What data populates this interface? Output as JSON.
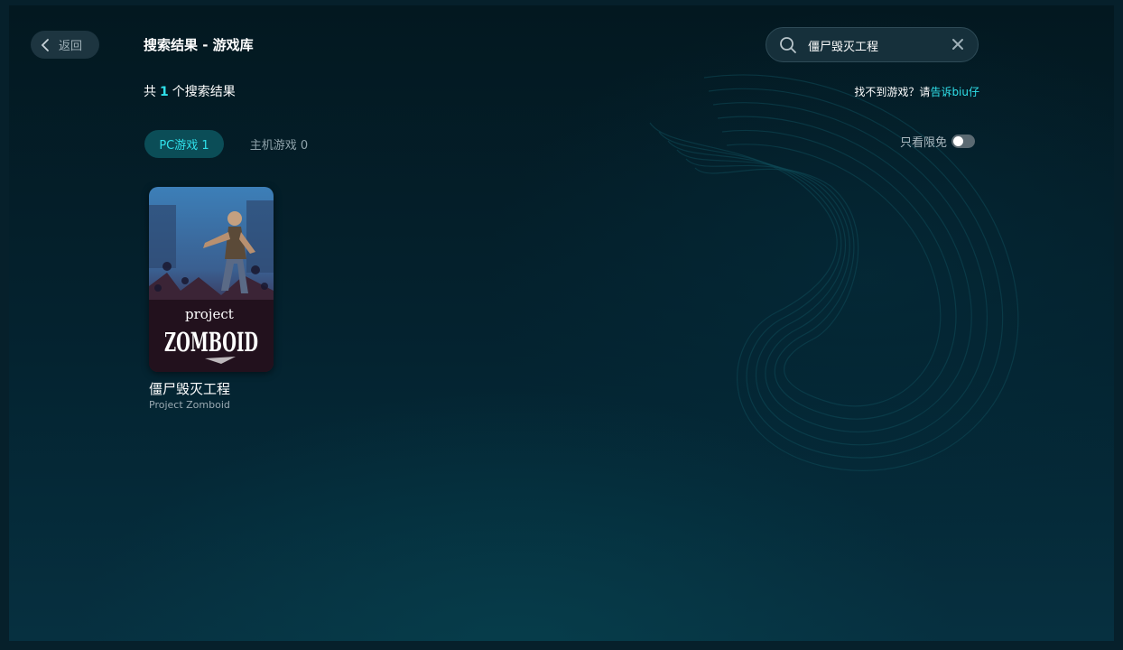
{
  "header": {
    "back_label": "返回",
    "title": "搜索结果 - 游戏库"
  },
  "search": {
    "value": "僵尸毁灭工程",
    "placeholder": ""
  },
  "results": {
    "prefix": "共",
    "count": "1",
    "suffix": "个搜索结果"
  },
  "feedback": {
    "text": "找不到游戏？请",
    "link": "告诉biu仔"
  },
  "tabs": [
    {
      "label": "PC游戏 1",
      "active": true
    },
    {
      "label": "主机游戏 0",
      "active": false
    }
  ],
  "filter": {
    "label": "只看限免",
    "enabled": false
  },
  "games": [
    {
      "name": "僵尸毁灭工程",
      "subtitle": "Project Zomboid",
      "cover_text_top": "project",
      "cover_text_main": "ZOMBOID"
    }
  ],
  "colors": {
    "accent": "#2fe0ea",
    "background": "#042330",
    "tab_active_bg": "#0b4d57"
  }
}
